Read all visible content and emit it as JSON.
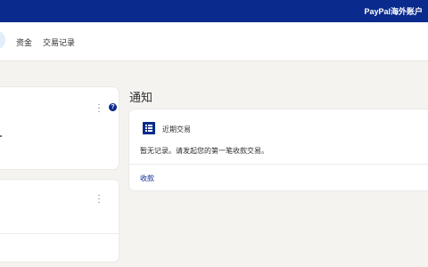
{
  "header": {
    "brand_label": "PayPal海外账户",
    "bg_color": "#0a2b8d"
  },
  "nav": {
    "items": [
      {
        "label": "资金"
      },
      {
        "label": "交易记录"
      }
    ]
  },
  "cards": {
    "help_glyph": "?",
    "menu_icon": "kebab-icon"
  },
  "notifications": {
    "title": "通知",
    "recent": {
      "icon": "list-icon",
      "title": "近期交易",
      "message": "暂无记录。请发起您的第一笔收款交易。",
      "action_label": "收款"
    }
  }
}
